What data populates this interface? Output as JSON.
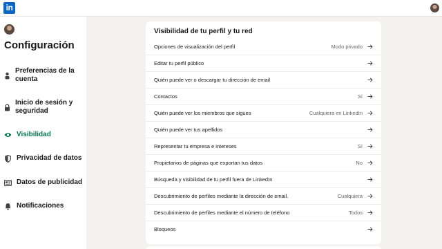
{
  "header": {
    "logo_text": "in",
    "brand_color": "#0a66c2"
  },
  "sidebar": {
    "title": "Configuración",
    "active_color": "#01754f",
    "items": [
      {
        "label": "Preferencias de la cuenta",
        "icon": "person-icon",
        "active": false
      },
      {
        "label": "Inicio de sesión y seguridad",
        "icon": "lock-icon",
        "active": false
      },
      {
        "label": "Visibilidad",
        "icon": "eye-icon",
        "active": true
      },
      {
        "label": "Privacidad de datos",
        "icon": "shield-icon",
        "active": false
      },
      {
        "label": "Datos de publicidad",
        "icon": "newspaper-icon",
        "active": false
      },
      {
        "label": "Notificaciones",
        "icon": "bell-icon",
        "active": false
      }
    ]
  },
  "main": {
    "section_title": "Visibilidad de tu perfil y tu red",
    "rows": [
      {
        "label": "Opciones de visualización del perfil",
        "value": "Modo privado"
      },
      {
        "label": "Editar tu perfil público",
        "value": ""
      },
      {
        "label": "Quién puede ver o descargar tu dirección de email",
        "value": ""
      },
      {
        "label": "Contactos",
        "value": "Sí"
      },
      {
        "label": "Quién puede ver los miembros que sigues",
        "value": "Cualquiera en LinkedIn"
      },
      {
        "label": "Quién puede ver tus apellidos",
        "value": ""
      },
      {
        "label": "Representar tu empresa e intereses",
        "value": "Sí"
      },
      {
        "label": "Propietarios de páginas que exportan tus datos",
        "value": "No"
      },
      {
        "label": "Búsqueda y visibilidad de tu perfil fuera de LinkedIn",
        "value": ""
      },
      {
        "label": "Descubrimiento de perfiles mediante la dirección de email.",
        "value": "Cualquiera"
      },
      {
        "label": "Descubrimiento de perfiles mediante el número de teléfono",
        "value": "Todos"
      },
      {
        "label": "Bloqueos",
        "value": ""
      }
    ]
  }
}
